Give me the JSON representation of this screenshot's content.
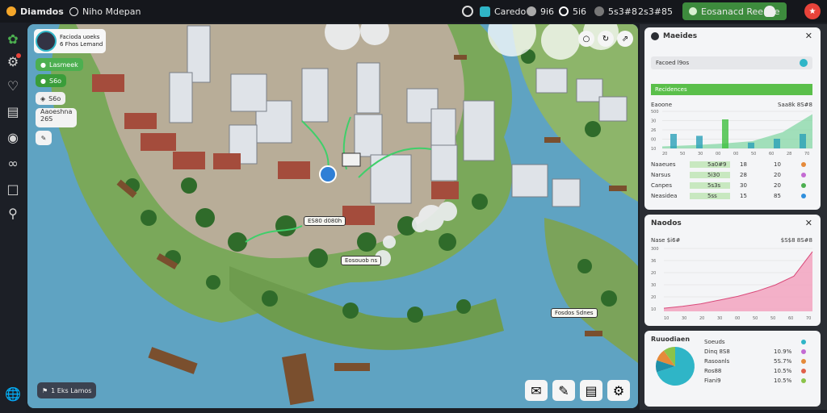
{
  "topbar": {
    "app_title": "Diamdos",
    "nav_label": "Niho Mdepan",
    "stat1": "Caredo",
    "stat2": "9i6",
    "stat3": "5i6",
    "stat4": "5s3#8",
    "stat5": "2s3#85",
    "cta_label": "Eosanacd Reeaue",
    "accent": "#4caf50"
  },
  "player": {
    "name": "Facioda uoeks",
    "subtitle": "6 Fhos Lemand",
    "badge1": "Lasmeek",
    "badge2": "S6o",
    "badge3": "S6o",
    "badge4": "Aaoeshna",
    "badge4b": "26S"
  },
  "map_labels": {
    "l1": "ES80 d080h",
    "l2": "Eosouob ns",
    "l3": "Fosdos Sdnes",
    "bottom_chip": "1 Eks Lamos"
  },
  "map_controls": [
    "zoom-in",
    "zoom-out",
    "share"
  ],
  "tools": [
    "chat",
    "edit",
    "report",
    "settings"
  ],
  "panel1": {
    "title": "Maeides",
    "subtitle": "Facoed l9os",
    "section": "Recidences",
    "head_left": "Eaoone",
    "head_right": "Saa8k  8S#8",
    "yaxis": [
      "500",
      "30",
      "26",
      "00",
      "10"
    ],
    "xaxis": [
      "20",
      "50",
      "30",
      "00",
      "00",
      "50",
      "60",
      "28",
      "70"
    ],
    "rows": [
      {
        "name": "Naaeues",
        "val": "5a0#9",
        "num": "18",
        "n2": "10",
        "color": "#e58a3a"
      },
      {
        "name": "Narsus",
        "val": "5i30",
        "num": "28",
        "n2": "20",
        "color": "#c46bd3"
      },
      {
        "name": "Canpes",
        "val": "5s3s",
        "num": "30",
        "n2": "20",
        "color": "#4caf50"
      },
      {
        "name": "Neasidea",
        "val": "5ss",
        "num": "15",
        "n2": "85",
        "color": "#2f8fdd"
      }
    ]
  },
  "panel2": {
    "title": "Naodos",
    "head_left": "Nase $i6#",
    "head_right": "$S$8  8S#8",
    "yaxis": [
      "300",
      "36",
      "20",
      "30",
      "20",
      "10"
    ],
    "xaxis": [
      "10",
      "30",
      "20",
      "30",
      "00",
      "50",
      "50",
      "60",
      "70"
    ]
  },
  "panel3": {
    "title": "Ruuodiaen",
    "rows": [
      {
        "name": "Soeuds",
        "val": "",
        "color": "#2fb5c7"
      },
      {
        "name": "Dinq 8S8",
        "val": "10.9%",
        "color": "#c46bd3"
      },
      {
        "name": "Rasoanls",
        "val": "5S.7%",
        "color": "#e58a3a"
      },
      {
        "name": "Ros88",
        "val": "10.5%",
        "color": "#e0604a"
      },
      {
        "name": "Fiani9",
        "val": "10.5%",
        "color": "#8bc34a"
      }
    ]
  },
  "chart_data": [
    {
      "type": "area",
      "title": "Recidences",
      "x": [
        20,
        30,
        40,
        50,
        60,
        70
      ],
      "series": [
        {
          "values": [
            5,
            8,
            12,
            18,
            40,
            85
          ]
        }
      ],
      "bars": [
        30,
        26,
        60,
        12,
        20,
        30
      ],
      "color": "#4caf50"
    },
    {
      "type": "area",
      "title": "Naodos",
      "x": [
        10,
        20,
        30,
        40,
        50,
        60,
        70
      ],
      "series": [
        {
          "values": [
            5,
            8,
            12,
            18,
            24,
            32,
            42,
            56,
            95
          ]
        }
      ],
      "color": "#e06b9a"
    },
    {
      "type": "pie",
      "title": "Ruuodiaen",
      "values": [
        70,
        10,
        10,
        10
      ],
      "colors": [
        "#2fb5c7",
        "#1e8fa8",
        "#e58a3a",
        "#8bc34a"
      ]
    }
  ]
}
